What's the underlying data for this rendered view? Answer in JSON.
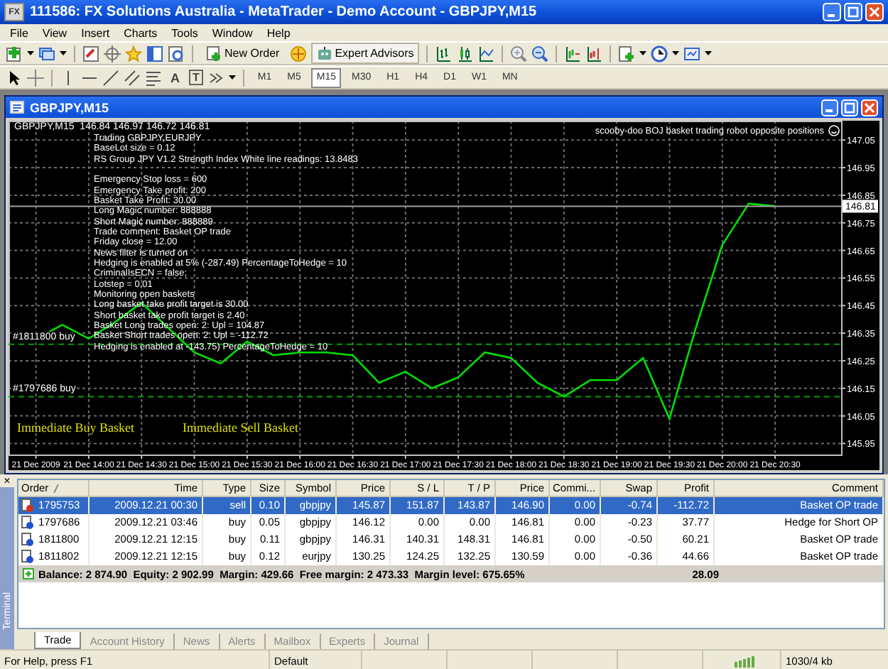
{
  "window": {
    "app_icon": "FX",
    "title": "111586: FX Solutions Australia - MetaTrader - Demo Account - GBPJPY,M15"
  },
  "menu": [
    "File",
    "View",
    "Insert",
    "Charts",
    "Tools",
    "Window",
    "Help"
  ],
  "toolbar": {
    "new_order": "New Order",
    "expert_advisors": "Expert Advisors",
    "text_tool": "A",
    "label_tool": "T",
    "periods": [
      {
        "label": "M1",
        "selected": false
      },
      {
        "label": "M5",
        "selected": false
      },
      {
        "label": "M15",
        "selected": true
      },
      {
        "label": "M30",
        "selected": false
      },
      {
        "label": "H1",
        "selected": false
      },
      {
        "label": "H4",
        "selected": false
      },
      {
        "label": "D1",
        "selected": false
      },
      {
        "label": "W1",
        "selected": false
      },
      {
        "label": "MN",
        "selected": false
      }
    ]
  },
  "chart_window": {
    "title": "GBPJPY,M15",
    "ohlc": "146.84 146.97 146.72 146.81",
    "expert": "scooby-doo BOJ basket trading robot opposite positions",
    "info_blocks": [
      [
        "Trading GBPJPY,EURJPY",
        "BaseLot size = 0.12",
        "RS Group JPY V1.2 Strength Index White line readings: 13.8483"
      ],
      [
        "Emergency Stop loss = 600",
        "Emergency Take profit: 200",
        "Basket Take Profit: 30.00",
        "Long Magic number: 888888",
        "Short Magic number: 888889",
        "Trade comment: Basket OP trade",
        "Friday close = 12.00",
        "News filter is turned on",
        "Hedging is enabled at 5% (-287.49) PercentageToHedge = 10",
        "CriminalIsECN = false;",
        "Lotstep = 0.01",
        "Monitoring open baskets",
        "Long basket take profit target is 30.00",
        "Short basket take profit target is 2.40",
        "Basket Long trades open: 2: Upl = 104.87",
        "Basket Short trades open: 2: Upl = -112.72",
        "Hedging is enabled at -143.75) PercentageToHedge = 10"
      ]
    ],
    "buttons": [
      "Immediate Buy Basket",
      "Immediate Sell Basket"
    ],
    "chart_data": {
      "type": "line",
      "grid": true,
      "categories": [
        "21 Dec 2009",
        null,
        "21 Dec 14:00",
        null,
        "21 Dec 14:30",
        null,
        "21 Dec 15:00",
        null,
        "21 Dec 15:30",
        null,
        "21 Dec 16:00",
        null,
        "21 Dec 16:30",
        null,
        "21 Dec 17:00",
        null,
        "21 Dec 17:30",
        null,
        "21 Dec 18:00",
        null,
        "21 Dec 18:30",
        null,
        "21 Dec 19:00",
        null,
        "21 Dec 19:30",
        null,
        "21 Dec 20:00",
        null,
        "21 Dec 20:30",
        null,
        null
      ],
      "series": [
        {
          "name": "GBPJPY,M15",
          "color": "#00e000",
          "values": [
            146.33,
            146.38,
            146.33,
            146.39,
            146.46,
            146.37,
            146.28,
            146.24,
            146.32,
            146.27,
            146.28,
            146.28,
            146.27,
            146.17,
            146.21,
            146.15,
            146.19,
            146.28,
            146.26,
            146.17,
            146.12,
            146.18,
            146.18,
            146.26,
            146.04,
            146.37,
            146.67,
            146.82,
            146.81,
            null,
            null
          ]
        }
      ],
      "ylim": [
        145.91,
        147.12
      ],
      "yticks": [
        {
          "value": 147.05,
          "label": "147.05"
        },
        {
          "value": 146.95,
          "label": "146.95"
        },
        {
          "value": 146.85,
          "label": "146.85"
        },
        {
          "value": 146.75,
          "label": "146.75"
        },
        {
          "value": 146.65,
          "label": "146.65"
        },
        {
          "value": 146.55,
          "label": "146.55"
        },
        {
          "value": 146.45,
          "label": "146.45"
        },
        {
          "value": 146.35,
          "label": "146.35"
        },
        {
          "value": 146.25,
          "label": "146.25"
        },
        {
          "value": 146.15,
          "label": "146.15"
        },
        {
          "value": 146.05,
          "label": "146.05"
        },
        {
          "value": 145.95,
          "label": "145.95"
        }
      ],
      "ref_lines": [
        {
          "axis": "y",
          "value": 146.31,
          "label": "#1811800 buy",
          "color": "#00a000"
        },
        {
          "axis": "y",
          "value": 146.12,
          "label": "#1797686 buy",
          "color": "#00a000"
        },
        {
          "axis": "y",
          "value": 146.81,
          "color": "#a0a0a0"
        }
      ],
      "annotations": [
        {
          "y": 146.81,
          "text": "146.81"
        }
      ]
    }
  },
  "terminal": {
    "title": "Terminal",
    "close": "×",
    "columns": [
      "Order",
      "Time",
      "Type",
      "Size",
      "Symbol",
      "Price",
      "S / L",
      "T / P",
      "Price",
      "Commi...",
      "Swap",
      "Profit",
      "Comment"
    ],
    "rows": [
      {
        "kind": "sell",
        "selected": true,
        "cells": [
          "1795753",
          "2009.12.21 00:30",
          "sell",
          "0.10",
          "gbpjpy",
          "145.87",
          "151.87",
          "143.87",
          "146.90",
          "0.00",
          "-0.74",
          "-112.72",
          "Basket OP trade"
        ]
      },
      {
        "kind": "buy",
        "selected": false,
        "cells": [
          "1797686",
          "2009.12.21 03:46",
          "buy",
          "0.05",
          "gbpjpy",
          "146.12",
          "0.00",
          "0.00",
          "146.81",
          "0.00",
          "-0.23",
          "37.77",
          "Hedge for Short OP"
        ]
      },
      {
        "kind": "buy",
        "selected": false,
        "cells": [
          "1811800",
          "2009.12.21 12:15",
          "buy",
          "0.11",
          "gbpjpy",
          "146.31",
          "140.31",
          "148.31",
          "146.81",
          "0.00",
          "-0.50",
          "60.21",
          "Basket OP trade"
        ]
      },
      {
        "kind": "buy",
        "selected": false,
        "cells": [
          "1811802",
          "2009.12.21 12:15",
          "buy",
          "0.12",
          "eurjpy",
          "130.25",
          "124.25",
          "132.25",
          "130.59",
          "0.00",
          "-0.36",
          "44.66",
          "Basket OP trade"
        ]
      }
    ],
    "summary": {
      "account": "Balance: 2 874.90  Equity: 2 902.99  Margin: 429.66  Free margin: 2 473.33  Margin level: 675.65%",
      "profit": "28.09"
    },
    "tabs": [
      {
        "label": "Trade",
        "selected": true
      },
      {
        "label": "Account History",
        "selected": false
      },
      {
        "label": "News",
        "selected": false
      },
      {
        "label": "Alerts",
        "selected": false
      },
      {
        "label": "Mailbox",
        "selected": false
      },
      {
        "label": "Experts",
        "selected": false
      },
      {
        "label": "Journal",
        "selected": false
      }
    ]
  },
  "status_bar": {
    "help": "For Help, press F1",
    "profile": "Default",
    "traffic": "1030/4 kb"
  }
}
